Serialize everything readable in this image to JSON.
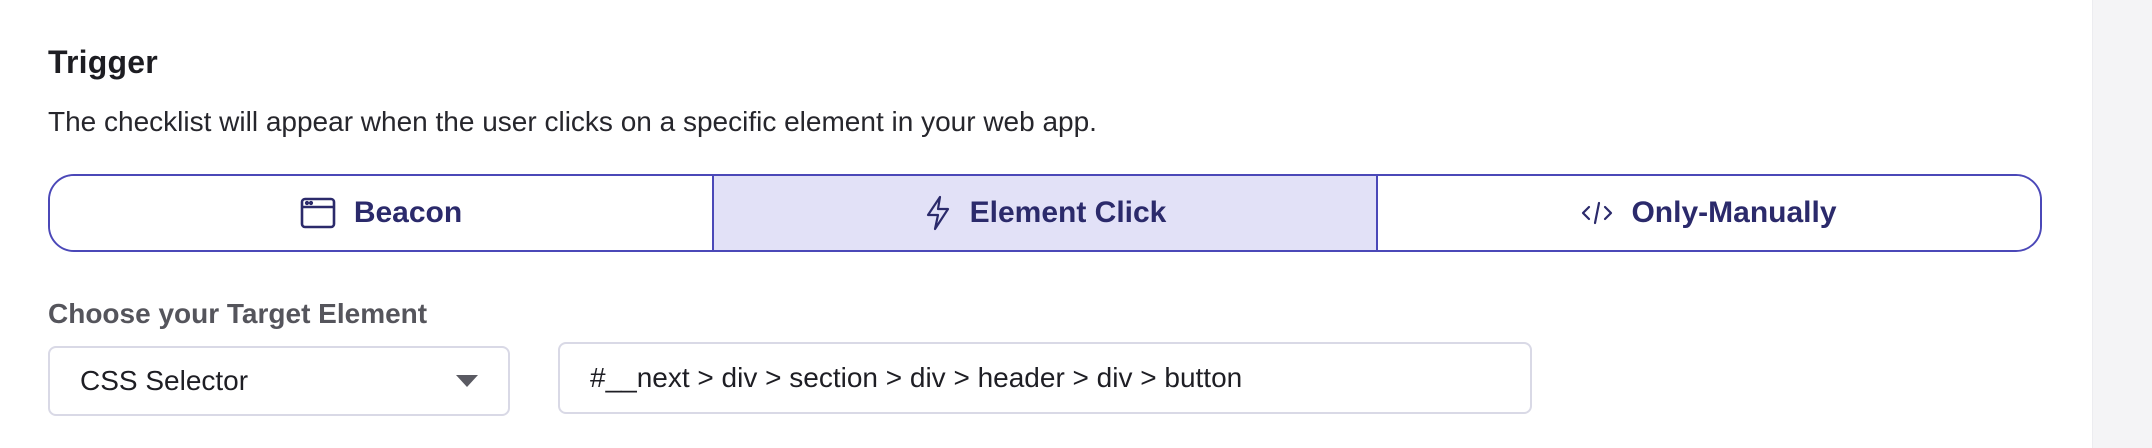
{
  "trigger": {
    "title": "Trigger",
    "description": "The checklist will appear when the user clicks on a specific element in your web app.",
    "options": [
      {
        "label": "Beacon",
        "icon": "browser-window-icon",
        "active": false
      },
      {
        "label": "Element Click",
        "icon": "lightning-icon",
        "active": true
      },
      {
        "label": "Only-Manually",
        "icon": "code-icon",
        "active": false
      }
    ]
  },
  "target": {
    "label": "Choose your Target Element",
    "selector_type": "CSS Selector",
    "selector_value": "#__next > div > section > div > header > div > button"
  },
  "colors": {
    "accent": "#4b48b8",
    "active_fill": "#e2e1f7",
    "accent_text": "#2b2a6b"
  }
}
